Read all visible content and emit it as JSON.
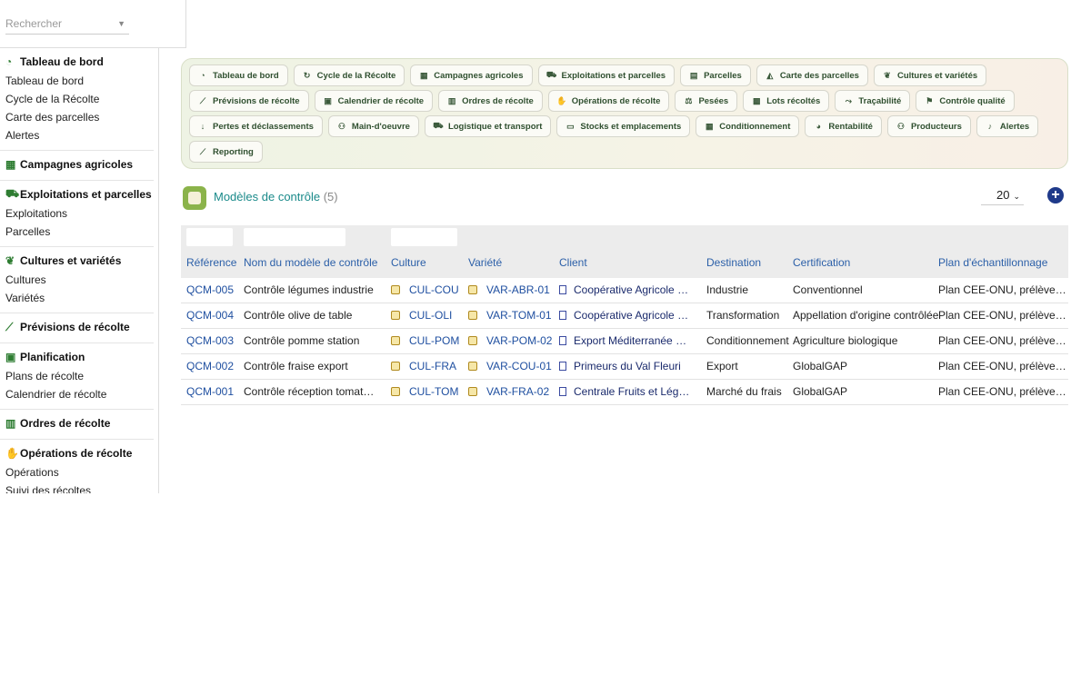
{
  "search": {
    "placeholder": "Rechercher"
  },
  "sidebar": {
    "groups": [
      {
        "title": "Tableau de bord",
        "icon": "dashboard-icon",
        "items": [
          "Tableau de bord",
          "Cycle de la Récolte",
          "Carte des parcelles",
          "Alertes"
        ]
      },
      {
        "title": "Campagnes agricoles",
        "icon": "calendar-icon",
        "items": []
      },
      {
        "title": "Exploitations et parcelles",
        "icon": "tractor-icon",
        "items": [
          "Exploitations",
          "Parcelles"
        ]
      },
      {
        "title": "Cultures et variétés",
        "icon": "seedling-icon",
        "items": [
          "Cultures",
          "Variétés"
        ]
      },
      {
        "title": "Prévisions de récolte",
        "icon": "chart-line-icon",
        "items": []
      },
      {
        "title": "Planification",
        "icon": "calendar-check-icon",
        "items": [
          "Plans de récolte",
          "Calendrier de récolte"
        ]
      },
      {
        "title": "Ordres de récolte",
        "icon": "clipboard-check-icon",
        "items": []
      },
      {
        "title": "Opérations de récolte",
        "icon": "hand-icon",
        "items": [
          "Opérations",
          "Suivi des récoltes"
        ]
      }
    ]
  },
  "nav": {
    "rows": [
      [
        {
          "label": "Tableau de bord",
          "icon": "dashboard-icon",
          "glyph": "◔"
        },
        {
          "label": "Cycle de la Récolte",
          "icon": "sync-icon",
          "glyph": "↻"
        },
        {
          "label": "Campagnes agricoles",
          "icon": "calendar-icon",
          "glyph": "▦"
        },
        {
          "label": "Exploitations et parcelles",
          "icon": "tractor-icon",
          "glyph": "⛟"
        },
        {
          "label": "Parcelles",
          "icon": "map-icon",
          "glyph": "▤"
        },
        {
          "label": "Carte des parcelles",
          "icon": "map-marked-icon",
          "glyph": "◭"
        },
        {
          "label": "Cultures et variétés",
          "icon": "seedling-icon",
          "glyph": "❦"
        }
      ],
      [
        {
          "label": "Prévisions de récolte",
          "icon": "chart-line-icon",
          "glyph": "⟋"
        },
        {
          "label": "Calendrier de récolte",
          "icon": "calendar-check-icon",
          "glyph": "▣"
        },
        {
          "label": "Ordres de récolte",
          "icon": "clipboard-check-icon",
          "glyph": "▥"
        },
        {
          "label": "Opérations de récolte",
          "icon": "hand-icon",
          "glyph": "✋"
        },
        {
          "label": "Pesées",
          "icon": "balance-icon",
          "glyph": "⚖"
        },
        {
          "label": "Lots récoltés",
          "icon": "box-icon",
          "glyph": "▩"
        },
        {
          "label": "Traçabilité",
          "icon": "route-icon",
          "glyph": "⤳"
        },
        {
          "label": "Contrôle qualité",
          "icon": "quality-icon",
          "glyph": "⚑"
        }
      ],
      [
        {
          "label": "Pertes et déclassements",
          "icon": "arrow-down-icon",
          "glyph": "↓"
        },
        {
          "label": "Main-d'oeuvre",
          "icon": "users-icon",
          "glyph": "⚇"
        },
        {
          "label": "Logistique et transport",
          "icon": "truck-icon",
          "glyph": "⛟"
        },
        {
          "label": "Stocks et emplacements",
          "icon": "warehouse-icon",
          "glyph": "▭"
        },
        {
          "label": "Conditionnement",
          "icon": "boxes-icon",
          "glyph": "▦"
        },
        {
          "label": "Rentabilité",
          "icon": "pie-chart-icon",
          "glyph": "◕"
        },
        {
          "label": "Producteurs",
          "icon": "users-icon",
          "glyph": "⚇"
        },
        {
          "label": "Alertes",
          "icon": "bell-icon",
          "glyph": "♪"
        }
      ],
      [
        {
          "label": "Reporting",
          "icon": "chart-area-icon",
          "glyph": "⟋"
        }
      ]
    ]
  },
  "page": {
    "title": "Modèles de contrôle",
    "count": "(5)",
    "page_size": "20"
  },
  "table": {
    "headers": [
      "Référence",
      "Nom du modèle de contrôle",
      "Culture",
      "Variété",
      "Client",
      "Destination",
      "Certification",
      "Plan d'échantillonnage"
    ],
    "rows": [
      {
        "ref": "QCM-005",
        "name": "Contrôle légumes industrie",
        "culture": "CUL-COU",
        "variete": "VAR-ABR-01",
        "client": "Coopérative Agricole de…",
        "destination": "Industrie",
        "certification": "Conventionnel",
        "plan": "Plan CEE-ONU, prélèveme…"
      },
      {
        "ref": "QCM-004",
        "name": "Contrôle olive de table",
        "culture": "CUL-OLI",
        "variete": "VAR-TOM-01",
        "client": "Coopérative Agricole de…",
        "destination": "Transformation",
        "certification": "Appellation d'origine contrôlée",
        "plan": "Plan CEE-ONU, prélèveme…"
      },
      {
        "ref": "QCM-003",
        "name": "Contrôle pomme station",
        "culture": "CUL-POM",
        "variete": "VAR-POM-02",
        "client": "Export Méditerranée Frais",
        "destination": "Conditionnement",
        "certification": "Agriculture biologique",
        "plan": "Plan CEE-ONU, prélèveme…"
      },
      {
        "ref": "QCM-002",
        "name": "Contrôle fraise export",
        "culture": "CUL-FRA",
        "variete": "VAR-COU-01",
        "client": "Primeurs du Val Fleuri",
        "destination": "Export",
        "certification": "GlobalGAP",
        "plan": "Plan CEE-ONU, prélèveme…"
      },
      {
        "ref": "QCM-001",
        "name": "Contrôle réception tomate …",
        "culture": "CUL-TOM",
        "variete": "VAR-FRA-02",
        "client": "Centrale Fruits et Légum…",
        "destination": "Marché du frais",
        "certification": "GlobalGAP",
        "plan": "Plan CEE-ONU, prélèveme…"
      }
    ]
  }
}
